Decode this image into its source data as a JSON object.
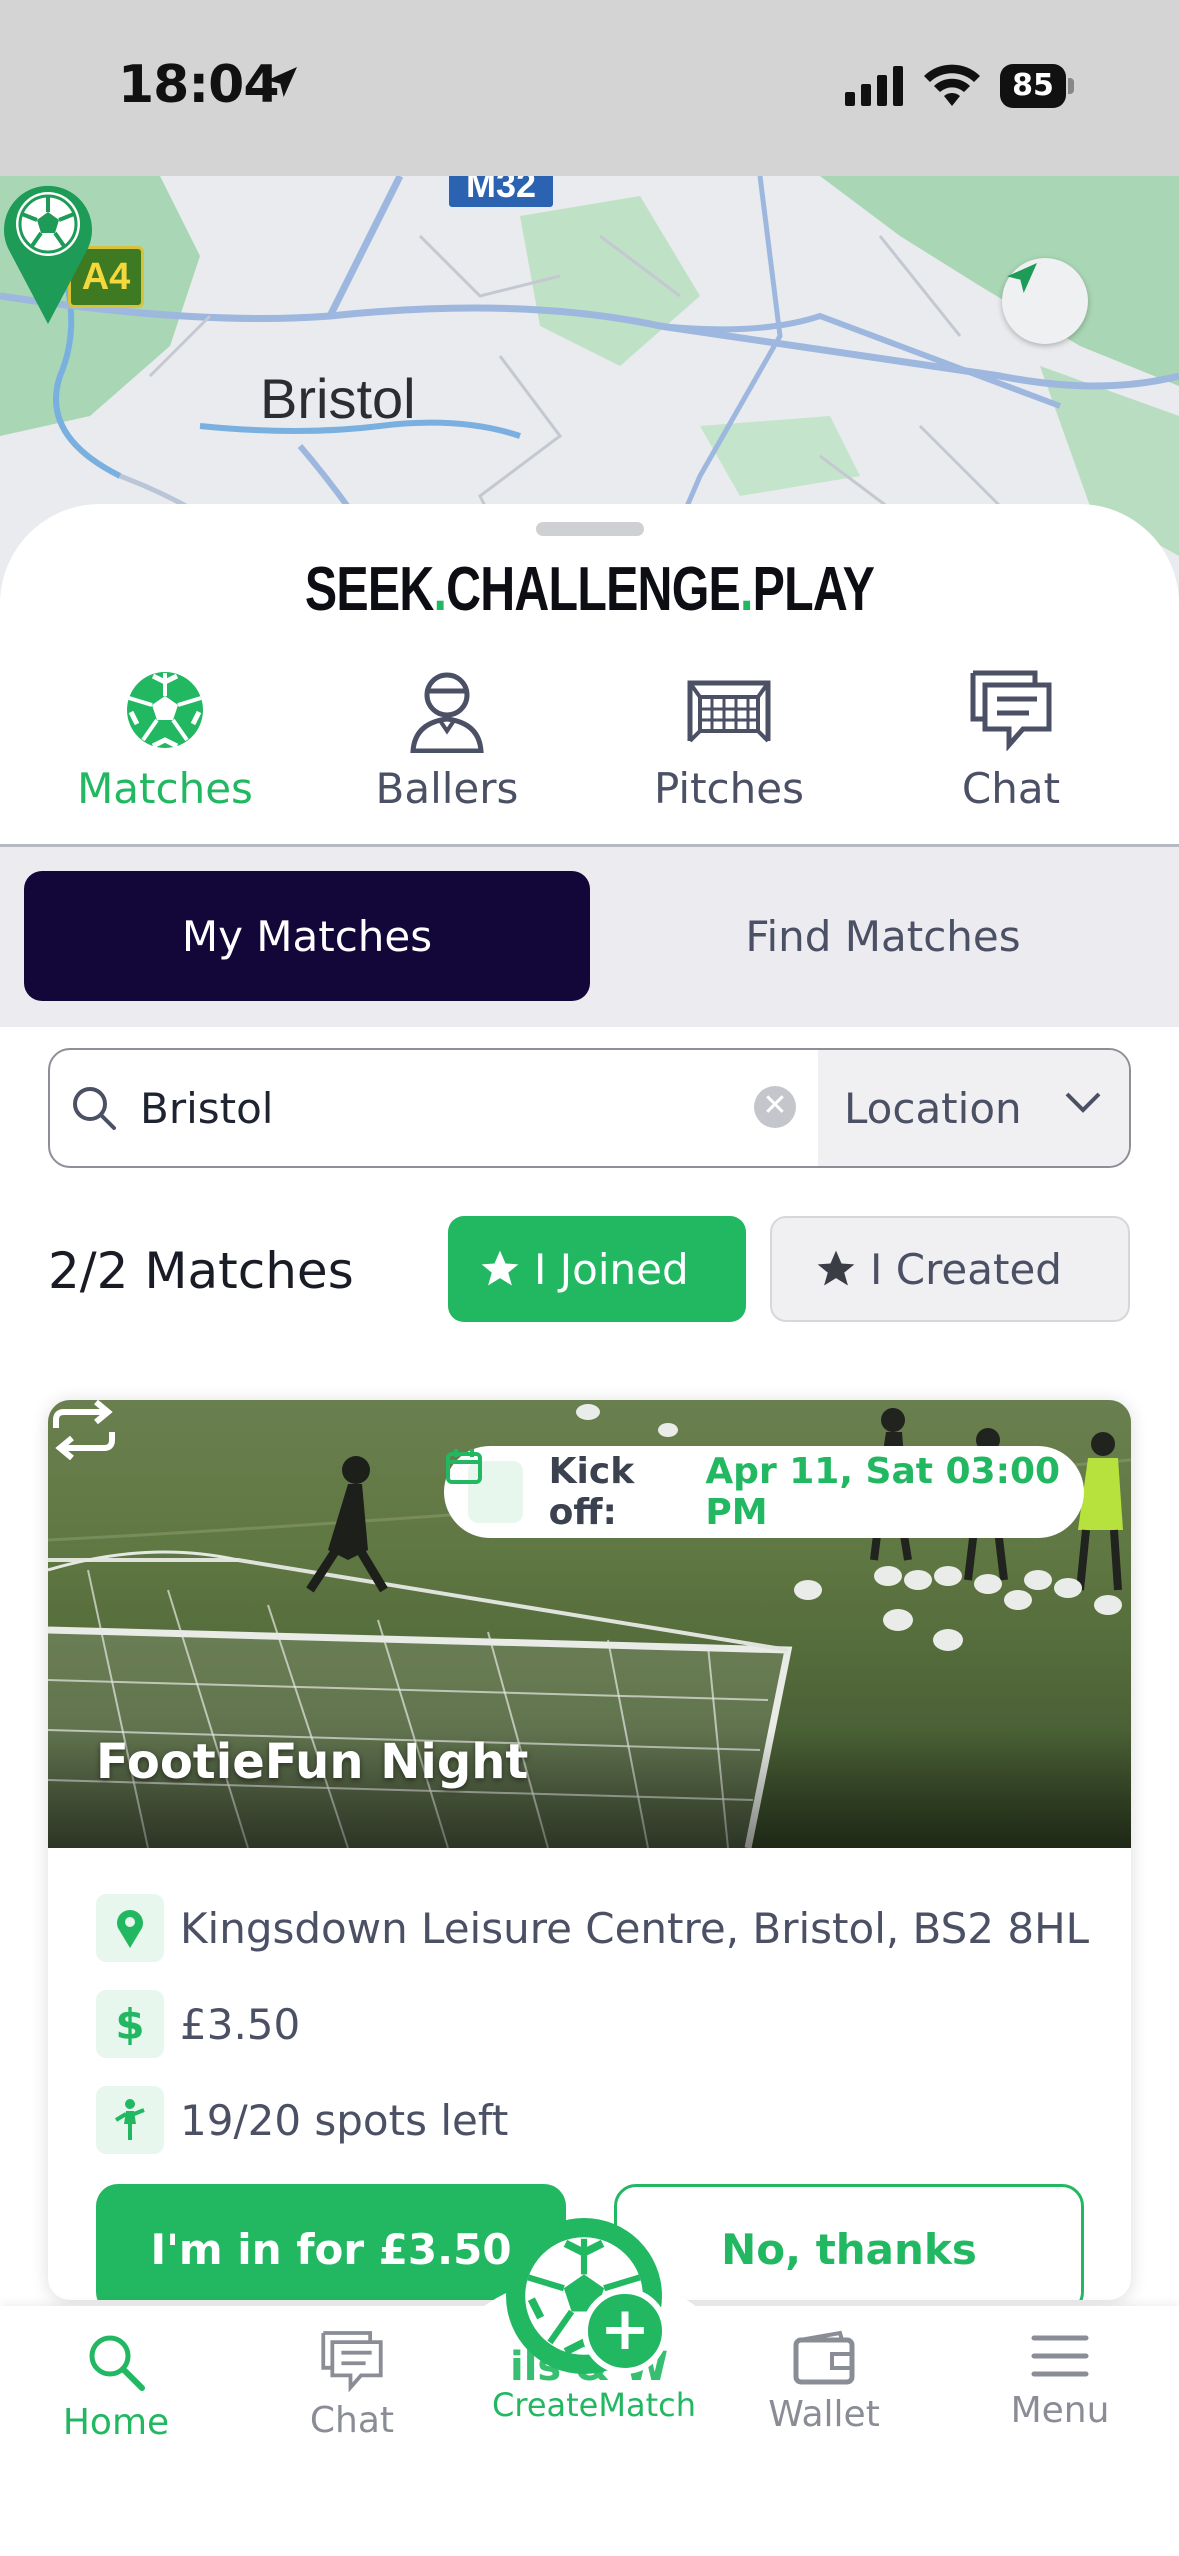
{
  "status_bar": {
    "time": "18:04",
    "battery": "85"
  },
  "map": {
    "city_label": "Bristol",
    "road_a4": "A4",
    "road_m32": "M32"
  },
  "brand": {
    "part1": "SEEK",
    "dot1": ".",
    "part2": "CHALLENGE",
    "dot2": ".",
    "part3": "PLAY"
  },
  "top_tabs": [
    {
      "label": "Matches",
      "icon": "soccer-ball-icon",
      "active": true
    },
    {
      "label": "Ballers",
      "icon": "player-icon",
      "active": false
    },
    {
      "label": "Pitches",
      "icon": "goal-net-icon",
      "active": false
    },
    {
      "label": "Chat",
      "icon": "chat-icon",
      "active": false
    }
  ],
  "segments": {
    "my_matches": "My Matches",
    "find_matches": "Find Matches"
  },
  "search": {
    "value": "Bristol",
    "filter_label": "Location"
  },
  "results": {
    "count": "2/2 Matches",
    "joined_chip": "I Joined",
    "created_chip": "I Created"
  },
  "match": {
    "kickoff_label": "Kick off:",
    "kickoff_value": "Apr 11, Sat 03:00 PM",
    "title": "FootieFun Night",
    "venue": "Kingsdown Leisure Centre, Bristol, BS2 8HL",
    "price": "£3.50",
    "spots": "19/20 spots left",
    "join_button": "I'm in for £3.50",
    "decline_button": "No, thanks"
  },
  "bottom_nav": {
    "home": "Home",
    "chat": "Chat",
    "create": "CreateMatch",
    "wallet": "Wallet",
    "menu": "Menu",
    "behind_text": "ils & W"
  },
  "colors": {
    "accent": "#22b862",
    "dark": "#13073a",
    "muted": "#4b5065"
  }
}
